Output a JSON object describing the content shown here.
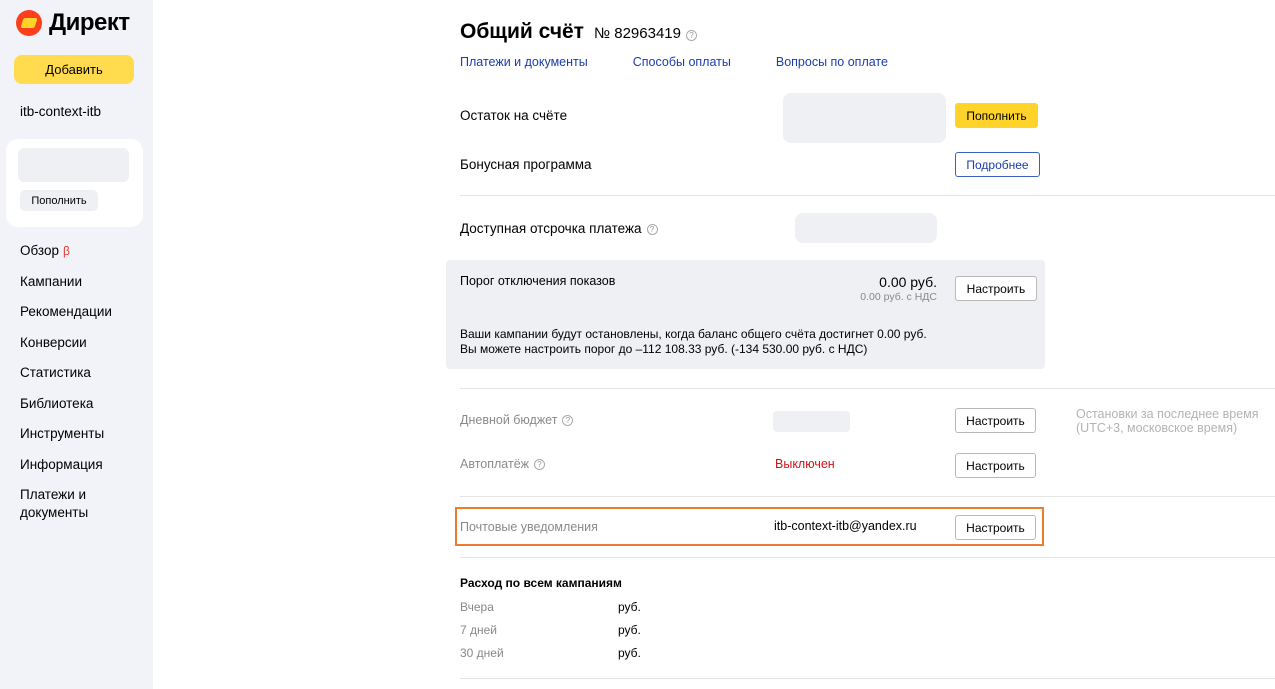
{
  "sidebar": {
    "logo_text": "Директ",
    "add_button": "Добавить",
    "login": "itb-context-itb",
    "topup_button": "Пополнить",
    "beta": "β",
    "nav": [
      "Обзор",
      "Кампании",
      "Рекомендации",
      "Конверсии",
      "Статистика",
      "Библиотека",
      "Инструменты",
      "Информация",
      "Платежи и документы"
    ]
  },
  "main": {
    "title": "Общий счёт",
    "account_number": "№ 82963419",
    "links": [
      "Платежи и документы",
      "Способы оплаты",
      "Вопросы по оплате"
    ],
    "balance_label": "Остаток на счёте",
    "topup_button": "Пополнить",
    "bonus_label": "Бонусная программа",
    "more_button": "Подробнее",
    "deferral_label": "Доступная отсрочка платежа",
    "threshold": {
      "label": "Порог отключения показов",
      "value": "0.00 руб.",
      "value_vat": "0.00 руб. с НДС",
      "button": "Настроить",
      "note_line1": "Ваши кампании будут остановлены, когда баланс общего счёта достигнет 0.00 руб.",
      "note_line2": "Вы можете настроить порог до –112 108.33 руб. (-134 530.00 руб. с НДС)"
    },
    "daily_budget_label": "Дневной бюджет",
    "daily_budget_button": "Настроить",
    "stops_hint_line1": "Остановки за последнее время",
    "stops_hint_line2": "(UTC+3, московское время)",
    "autopay_label": "Автоплатёж",
    "autopay_status": "Выключен",
    "autopay_button": "Настроить",
    "email_label": "Почтовые уведомления",
    "email_value": "itb-context-itb@yandex.ru",
    "email_button": "Настроить",
    "spend": {
      "title": "Расход по всем кампаниям",
      "rows": [
        {
          "period": "Вчера",
          "value": "руб."
        },
        {
          "period": "7 дней",
          "value": "руб."
        },
        {
          "period": "30 дней",
          "value": "руб."
        }
      ]
    }
  },
  "colors": {
    "accent_yellow": "#fed42b",
    "link_blue": "#1a3dac",
    "highlight_orange": "#ef7b2d",
    "status_red": "#d0141b"
  }
}
